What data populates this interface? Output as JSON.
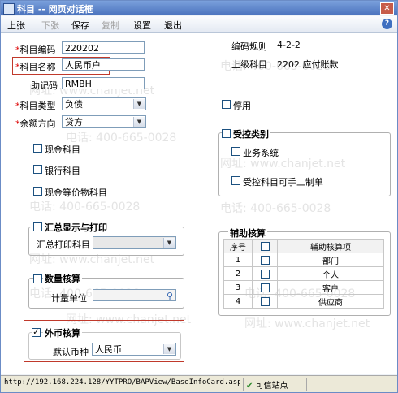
{
  "window": {
    "title": "科目 -- 网页对话框"
  },
  "toolbar": {
    "items": [
      "上张",
      "下张",
      "保存",
      "复制",
      "设置",
      "退出"
    ],
    "help": "?"
  },
  "form": {
    "code_label": "科目编码",
    "code_value": "220202",
    "name_label": "科目名称",
    "name_value": "人民币户",
    "mnemonic_label": "助记码",
    "mnemonic_value": "RMBH",
    "type_label": "科目类型",
    "type_value": "负债",
    "direction_label": "余额方向",
    "direction_value": "贷方",
    "cash_label": "现金科目",
    "bank_label": "银行科目",
    "equiv_label": "现金等价物科目",
    "rule_label": "编码规则",
    "rule_value": "4-2-2",
    "parent_label": "上级科目",
    "parent_value": "2202 应付账款",
    "disabled_label": "停用",
    "controlled_title": "受控类别",
    "business_label": "业务系统",
    "manual_label": "受控科目可手工制单",
    "summary_title": "汇总显示与打印",
    "summary_print_label": "汇总打印科目",
    "qty_title": "数量核算",
    "unit_label": "计量单位",
    "fx_title": "外币核算",
    "currency_label": "默认币种",
    "currency_value": "人民币",
    "aux_title": "辅助核算"
  },
  "aux_table": {
    "headers": [
      "序号",
      "",
      "辅助核算项"
    ],
    "rows": [
      {
        "no": "1",
        "name": "部门"
      },
      {
        "no": "2",
        "name": "个人"
      },
      {
        "no": "3",
        "name": "客户"
      },
      {
        "no": "4",
        "name": "供应商"
      }
    ]
  },
  "watermark": {
    "phone": "电话: 400-665-0028",
    "site": "网址: www.chanjet.net"
  },
  "statusbar": {
    "url": "http://192.168.224.128/YYTPRO/BAPView/BaseInfoCard.aspx",
    "zone": "可信站点"
  },
  "colors": {
    "accent": "#4a72bd",
    "highlight": "#c0392b"
  }
}
